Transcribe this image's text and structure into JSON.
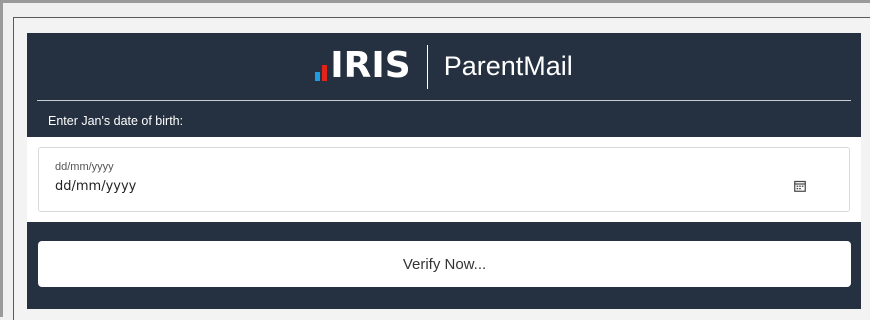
{
  "brand": {
    "logo_text": "IRIS",
    "product_name": "ParentMail",
    "colors": {
      "panel_bg": "#253140",
      "bar_blue": "#1f9be0",
      "bar_red": "#e2231a"
    }
  },
  "form": {
    "prompt": "Enter Jan's date of birth:",
    "date_field": {
      "placeholder": "dd/mm/yyyy",
      "value": "dd/mm/yyyy",
      "icon": "calendar-icon"
    },
    "submit_label": "Verify Now..."
  }
}
